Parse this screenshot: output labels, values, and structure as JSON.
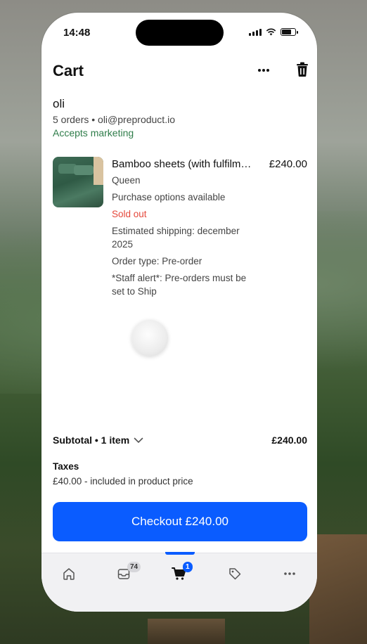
{
  "status_bar": {
    "time": "14:48"
  },
  "header": {
    "title": "Cart",
    "more_icon": "ellipsis-icon",
    "delete_icon": "trash-icon"
  },
  "customer": {
    "name": "oli",
    "meta": "5 orders • oli@preproduct.io",
    "marketing": "Accepts marketing"
  },
  "line_item": {
    "name": "Bamboo sheets (with fulfilm…",
    "price": "£240.00",
    "details": [
      "Queen",
      "Purchase options available",
      "Sold out",
      "Estimated shipping: december 2025",
      "Order type: Pre-order",
      "*Staff alert*: Pre-orders must be set to Ship"
    ]
  },
  "summary": {
    "subtotal_label": "Subtotal • 1 item",
    "subtotal_value": "£240.00",
    "taxes_label": "Taxes",
    "taxes_detail": "£40.00 - included in product price"
  },
  "checkout": {
    "label": "Checkout £240.00"
  },
  "tabbar": {
    "tabs": [
      {
        "icon": "home-icon"
      },
      {
        "icon": "inbox-icon",
        "badge": "74"
      },
      {
        "icon": "cart-icon",
        "badge": "1",
        "active": true
      },
      {
        "icon": "tag-icon"
      },
      {
        "icon": "more-icon"
      }
    ]
  },
  "colors": {
    "accent": "#0a5cff",
    "sold_out": "#e5483b",
    "marketing": "#2f7d4a"
  }
}
